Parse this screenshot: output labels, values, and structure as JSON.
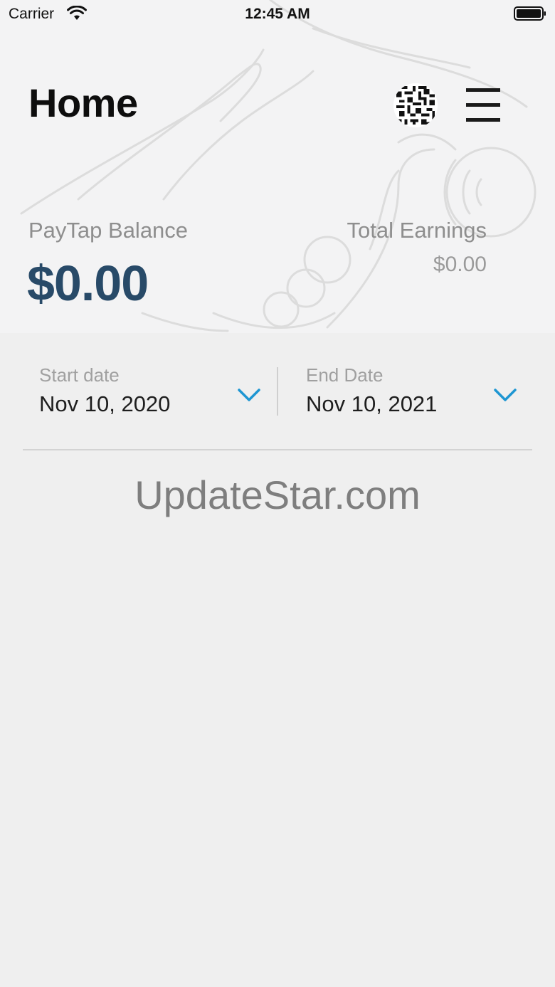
{
  "status_bar": {
    "carrier": "Carrier",
    "time": "12:45 AM"
  },
  "header": {
    "title": "Home",
    "qr_icon": "qr-code-icon",
    "menu_icon": "hamburger-menu-icon"
  },
  "balance": {
    "label": "PayTap Balance",
    "value": "$0.00"
  },
  "earnings": {
    "label": "Total Earnings",
    "value": "$0.00"
  },
  "date_filter": {
    "start": {
      "label": "Start date",
      "value": "Nov 10,  2020"
    },
    "end": {
      "label": "End Date",
      "value": "Nov 10,  2021"
    }
  },
  "watermark": "UpdateStar.com",
  "colors": {
    "balance": "#284a68",
    "accent_chevron": "#1e96d2",
    "background": "#efefef"
  }
}
